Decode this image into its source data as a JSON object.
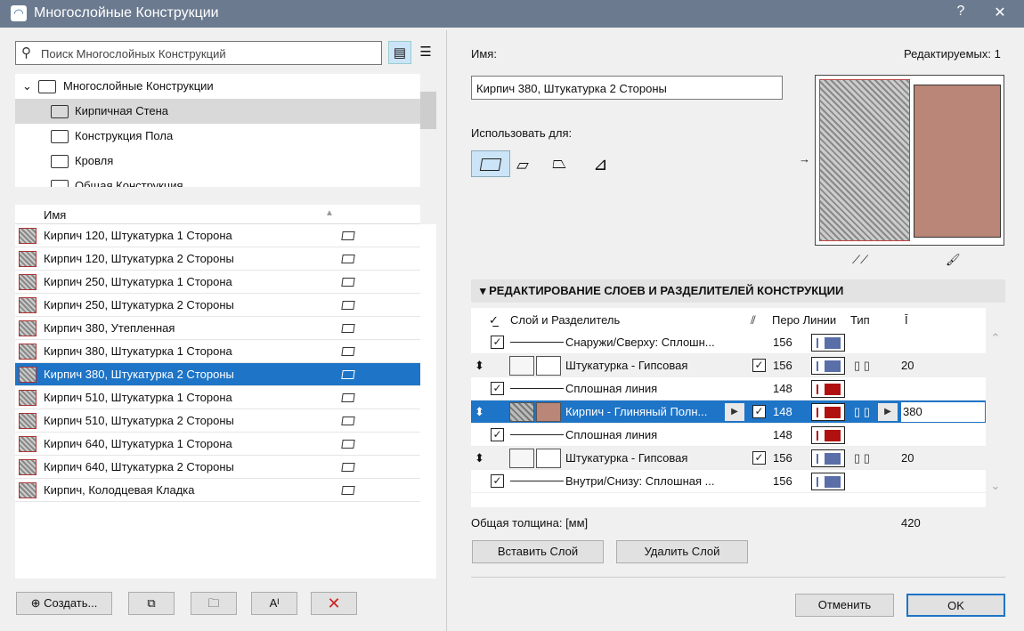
{
  "window": {
    "title": "Многослойные Конструкции",
    "help": "?",
    "close": "✕"
  },
  "search": {
    "placeholder": "Поиск Многослойных Конструкций"
  },
  "tree": {
    "root": "Многослойные Конструкции",
    "folders": [
      "Кирпичная Стена",
      "Конструкция Пола",
      "Кровля",
      "Общая Конструкция"
    ],
    "selected": 0
  },
  "list": {
    "header": "Имя",
    "items": [
      "Кирпич 120, Штукатурка 1 Сторона",
      "Кирпич 120, Штукатурка 2 Стороны",
      "Кирпич 250, Штукатурка 1 Сторона",
      "Кирпич 250, Штукатурка 2 Стороны",
      "Кирпич 380, Утепленная",
      "Кирпич 380, Штукатурка 1 Сторона",
      "Кирпич 380, Штукатурка 2 Стороны",
      "Кирпич 510, Штукатурка 1 Сторона",
      "Кирпич 510, Штукатурка 2 Стороны",
      "Кирпич 640, Штукатурка 1 Сторона",
      "Кирпич 640, Штукатурка 2 Стороны",
      "Кирпич, Колодцевая Кладка"
    ],
    "selected": 6
  },
  "bottom_left": {
    "create": "Создать..."
  },
  "right": {
    "name_label": "Имя:",
    "editable": "Редактируемых: 1",
    "name_value": "Кирпич 380, Штукатурка 2 Стороны",
    "use_for": "Использовать для:"
  },
  "section": {
    "title": "РЕДАКТИРОВАНИЕ СЛОЕВ И РАЗДЕЛИТЕЛЕЙ КОНСТРУКЦИИ"
  },
  "layers": {
    "headers": {
      "layer": "Слой и Разделитель",
      "pen": "Перо Линии",
      "type": "Тип"
    },
    "rows": [
      {
        "kind": "line",
        "name": "Снаружи/Сверху: Сплошн...",
        "pen": "156",
        "color": "#5a6ea8"
      },
      {
        "kind": "layer",
        "name": "Штукатурка - Гипсовая",
        "pen": "156",
        "color": "#5a6ea8",
        "thickness": "20"
      },
      {
        "kind": "line",
        "name": "Сплошная линия",
        "pen": "148",
        "color": "#b01010"
      },
      {
        "kind": "layer",
        "name": "Кирпич - Глиняный Полн...",
        "pen": "148",
        "color": "#b01010",
        "thickness": "380",
        "selected": true
      },
      {
        "kind": "line",
        "name": "Сплошная линия",
        "pen": "148",
        "color": "#b01010"
      },
      {
        "kind": "layer",
        "name": "Штукатурка - Гипсовая",
        "pen": "156",
        "color": "#5a6ea8",
        "thickness": "20"
      },
      {
        "kind": "line",
        "name": "Внутри/Снизу: Сплошная ...",
        "pen": "156",
        "color": "#5a6ea8"
      }
    ]
  },
  "total": {
    "label": "Общая толщина: [мм]",
    "value": "420"
  },
  "buttons": {
    "insert": "Вставить Слой",
    "delete": "Удалить Слой",
    "cancel": "Отменить",
    "ok": "OK"
  }
}
